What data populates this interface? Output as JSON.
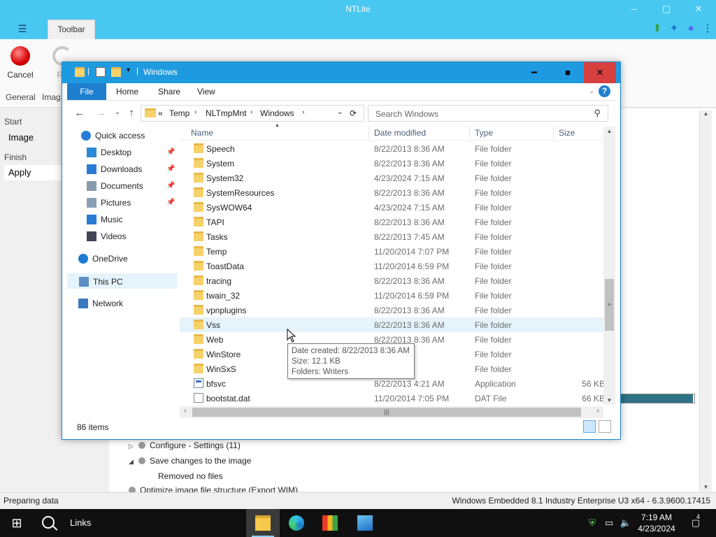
{
  "app": {
    "title": "NTLite",
    "tab_toolbar": "Toolbar",
    "menu_icon": "hamburger-icon",
    "ribbon": {
      "cancel_label": "Cancel",
      "refresh_label": "Re",
      "group_general": "General",
      "group_image": "Imag"
    },
    "left_nav": {
      "start_heading": "Start",
      "image_item": "Image",
      "finish_heading": "Finish",
      "apply_item": "Apply"
    },
    "tasks": [
      {
        "label": "Configure - Settings (11)",
        "expander": "▷"
      },
      {
        "label": "Save changes to the image",
        "expander": "◢"
      },
      {
        "label": "Removed no files",
        "expander": ""
      },
      {
        "label": "Optimize image file structure (Export WIM)",
        "expander": ""
      }
    ],
    "progress_fraction": 0.98,
    "status_left": "Preparing data",
    "status_right": "Windows Embedded 8.1 Industry Enterprise U3 x64 - 6.3.9600.17415"
  },
  "explorer": {
    "title": "Windows",
    "menu": {
      "file": "File",
      "home": "Home",
      "share": "Share",
      "view": "View"
    },
    "address": {
      "prefix": "«",
      "crumbs": [
        "Temp",
        "NLTmpMnt",
        "Windows"
      ]
    },
    "search_placeholder": "Search Windows",
    "nav": [
      {
        "label": "Quick access",
        "icon": "star-icon",
        "pinned": false
      },
      {
        "label": "Desktop",
        "icon": "desktop-icon",
        "pinned": true
      },
      {
        "label": "Downloads",
        "icon": "download-icon",
        "pinned": true
      },
      {
        "label": "Documents",
        "icon": "documents-icon",
        "pinned": true
      },
      {
        "label": "Pictures",
        "icon": "pictures-icon",
        "pinned": true
      },
      {
        "label": "Music",
        "icon": "music-icon",
        "pinned": false
      },
      {
        "label": "Videos",
        "icon": "videos-icon",
        "pinned": false
      },
      {
        "label": "OneDrive",
        "icon": "cloud-icon",
        "pinned": false
      },
      {
        "label": "This PC",
        "icon": "computer-icon",
        "pinned": false
      },
      {
        "label": "Network",
        "icon": "network-icon",
        "pinned": false
      }
    ],
    "columns": {
      "name": "Name",
      "date": "Date modified",
      "type": "Type",
      "size": "Size"
    },
    "rows": [
      {
        "name": "Speech",
        "date": "8/22/2013 8:36 AM",
        "type": "File folder",
        "size": "",
        "kind": "folder"
      },
      {
        "name": "System",
        "date": "8/22/2013 8:36 AM",
        "type": "File folder",
        "size": "",
        "kind": "folder"
      },
      {
        "name": "System32",
        "date": "4/23/2024 7:15 AM",
        "type": "File folder",
        "size": "",
        "kind": "folder"
      },
      {
        "name": "SystemResources",
        "date": "8/22/2013 8:36 AM",
        "type": "File folder",
        "size": "",
        "kind": "folder"
      },
      {
        "name": "SysWOW64",
        "date": "4/23/2024 7:15 AM",
        "type": "File folder",
        "size": "",
        "kind": "folder"
      },
      {
        "name": "TAPI",
        "date": "8/22/2013 8:36 AM",
        "type": "File folder",
        "size": "",
        "kind": "folder"
      },
      {
        "name": "Tasks",
        "date": "8/22/2013 7:45 AM",
        "type": "File folder",
        "size": "",
        "kind": "folder"
      },
      {
        "name": "Temp",
        "date": "11/20/2014 7:07 PM",
        "type": "File folder",
        "size": "",
        "kind": "folder"
      },
      {
        "name": "ToastData",
        "date": "11/20/2014 6:59 PM",
        "type": "File folder",
        "size": "",
        "kind": "folder"
      },
      {
        "name": "tracing",
        "date": "8/22/2013 8:36 AM",
        "type": "File folder",
        "size": "",
        "kind": "folder"
      },
      {
        "name": "twain_32",
        "date": "11/20/2014 6:59 PM",
        "type": "File folder",
        "size": "",
        "kind": "folder"
      },
      {
        "name": "vpnplugins",
        "date": "8/22/2013 8:36 AM",
        "type": "File folder",
        "size": "",
        "kind": "folder"
      },
      {
        "name": "Vss",
        "date": "8/22/2013 8:36 AM",
        "type": "File folder",
        "size": "",
        "kind": "folder"
      },
      {
        "name": "Web",
        "date": "8/22/2013 8:36 AM",
        "type": "File folder",
        "size": "",
        "kind": "folder"
      },
      {
        "name": "WinStore",
        "date": "6:59 PM",
        "type": "File folder",
        "size": "",
        "kind": "folder"
      },
      {
        "name": "WinSxS",
        "date": ":15 AM",
        "type": "File folder",
        "size": "",
        "kind": "folder"
      },
      {
        "name": "bfsvc",
        "date": "8/22/2013 4:21 AM",
        "type": "Application",
        "size": "56 KB",
        "kind": "app"
      },
      {
        "name": "bootstat.dat",
        "date": "11/20/2014 7:05 PM",
        "type": "DAT File",
        "size": "66 KB",
        "kind": "file"
      }
    ],
    "hovered_row": 12,
    "tooltip": {
      "line1": "Date created: 8/22/2013 8:36 AM",
      "line2": "Size: 12.1 KB",
      "line3": "Folders: Writers"
    },
    "item_count": "86 items"
  },
  "taskbar": {
    "search_label": "Links",
    "time": "7:19 AM",
    "date": "4/23/2024",
    "notification_count": "4"
  },
  "colors": {
    "ntlite_accent": "#48c8f0",
    "explorer_title": "#1e9be0",
    "file_tab": "#1e7fcf",
    "progress": "#2f7386",
    "close_button": "#d84040"
  }
}
